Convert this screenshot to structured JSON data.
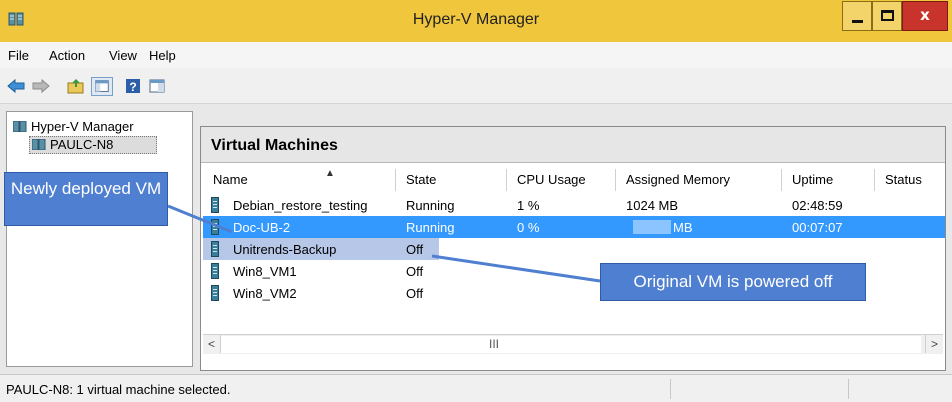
{
  "window": {
    "title": "Hyper-V Manager",
    "close_glyph": "x",
    "title_bar_color": "#f0c63c"
  },
  "menu": [
    "File",
    "Action",
    "View",
    "Help"
  ],
  "toolbar": {
    "icons": [
      "back-arrow-icon",
      "forward-arrow-icon",
      "folder-up-icon",
      "show-hide-tree-icon",
      "help-icon",
      "action-pane-icon"
    ]
  },
  "tree": {
    "root": "Hyper-V Manager",
    "server": "PAULC-N8"
  },
  "pane": {
    "title": "Virtual Machines",
    "columns": [
      "Name",
      "State",
      "CPU Usage",
      "Assigned Memory",
      "Uptime",
      "Status"
    ],
    "rows": [
      {
        "name": "Debian_restore_testing",
        "state": "Running",
        "cpu": "1 %",
        "memory": "1024 MB",
        "uptime": "02:48:59",
        "status": ""
      },
      {
        "name": "Doc-UB-2",
        "state": "Running",
        "cpu": "0 %",
        "memory": "MB",
        "uptime": "00:07:07",
        "status": ""
      },
      {
        "name": "Unitrends-Backup",
        "state": "Off",
        "cpu": "",
        "memory": "",
        "uptime": "",
        "status": ""
      },
      {
        "name": "Win8_VM1",
        "state": "Off",
        "cpu": "",
        "memory": "",
        "uptime": "",
        "status": ""
      },
      {
        "name": "Win8_VM2",
        "state": "Off",
        "cpu": "",
        "memory": "",
        "uptime": "",
        "status": ""
      }
    ],
    "scroll_grip": "III",
    "scroll_left": "<",
    "scroll_right": ">"
  },
  "callouts": {
    "new_vm": "Newly deployed VM",
    "original_vm": "Original VM is powered off",
    "color": "#4f7fd0"
  },
  "status": {
    "text": "PAULC-N8:  1 virtual machine selected."
  }
}
